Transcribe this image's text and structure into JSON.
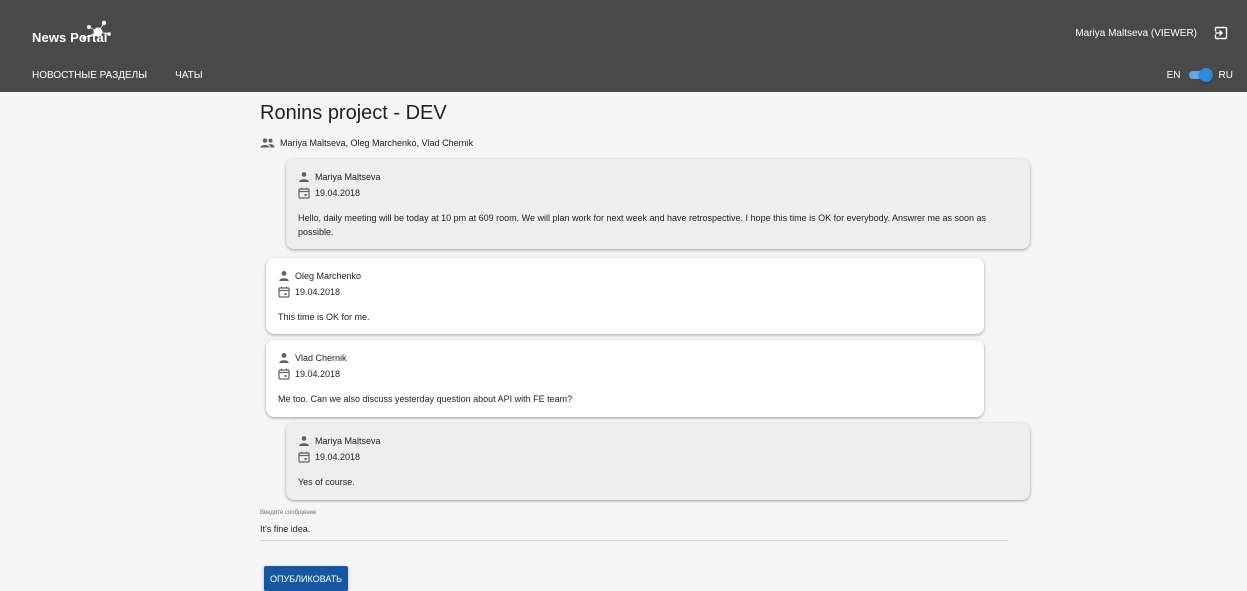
{
  "app": {
    "logo_text": "News Portal"
  },
  "nav": {
    "items": [
      {
        "label": "НОВОСТНЫЕ РАЗДЕЛЫ"
      },
      {
        "label": "ЧАТЫ"
      }
    ]
  },
  "user": {
    "label": "Mariya Maltseva (VIEWER)",
    "logout_icon": "logout-icon"
  },
  "lang": {
    "left": "EN",
    "right": "RU",
    "selected": "RU"
  },
  "chat": {
    "title": "Ronins project - DEV",
    "participants_icon": "group-icon",
    "participants": "Mariya Maltseva, Oleg Marchenko, Vlad Chernik"
  },
  "messages": [
    {
      "author": "Mariya Maltseva",
      "date": "19.04.2018",
      "text": "Hello, daily meeting will be today at 10 pm at 609 room. We will plan work for next week and have retrospective. I hope this time is OK for everybody. Answrer me as soon as possible.",
      "own": true
    },
    {
      "author": "Oleg Marchenko",
      "date": "19.04.2018",
      "text": "This time is OK for me.",
      "own": false
    },
    {
      "author": "Vlad Chernik",
      "date": "19.04.2018",
      "text": "Me too. Can we also discuss yesterday question about API with FE team?",
      "own": false
    },
    {
      "author": "Mariya Maltseva",
      "date": "19.04.2018",
      "text": "Yes of course.",
      "own": true
    }
  ],
  "composer": {
    "label": "Введите сообщение",
    "value": "It's fine idea.",
    "publish_label": "ОПУБЛИКОВАТЬ"
  },
  "colors": {
    "header_bg": "#494949",
    "page_bg": "#f5f5f5",
    "own_msg_bg": "#eeeeee",
    "other_msg_bg": "#ffffff",
    "primary": "#1557a0",
    "toggle": "#2c8bd8"
  }
}
